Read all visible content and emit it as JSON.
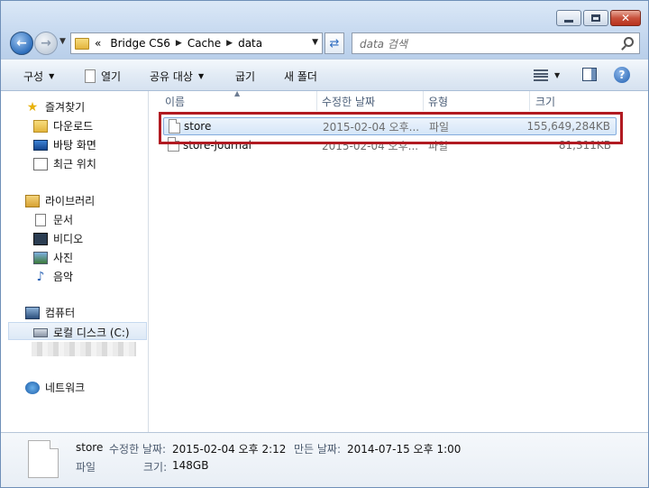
{
  "window": {
    "controls": [
      "minimize",
      "maximize",
      "close"
    ]
  },
  "address": {
    "prefix": "«",
    "crumbs": [
      "Bridge CS6",
      "Cache",
      "data"
    ]
  },
  "search": {
    "placeholder": "data 검색"
  },
  "toolbar": {
    "organize": "구성",
    "open": "열기",
    "share": "공유 대상",
    "burn": "굽기",
    "new_folder": "새 폴더"
  },
  "sidebar": {
    "favorites": {
      "label": "즐겨찾기",
      "items": [
        "다운로드",
        "바탕 화면",
        "최근 위치"
      ]
    },
    "libraries": {
      "label": "라이브러리",
      "items": [
        "문서",
        "비디오",
        "사진",
        "음악"
      ]
    },
    "computer": {
      "label": "컴퓨터",
      "items": [
        "로컬 디스크 (C:)"
      ]
    },
    "network": {
      "label": "네트워크"
    }
  },
  "columns": {
    "name": "이름",
    "date": "수정한 날짜",
    "type": "유형",
    "size": "크기"
  },
  "files": [
    {
      "name": "store",
      "date": "2015-02-04 오후...",
      "type": "파일",
      "size": "155,649,284KB",
      "selected": true
    },
    {
      "name": "store-journal",
      "date": "2015-02-04 오후...",
      "type": "파일",
      "size": "81,311KB",
      "selected": false
    }
  ],
  "details": {
    "name": "store",
    "type": "파일",
    "modified_label": "수정한 날짜:",
    "modified": "2015-02-04 오후 2:12",
    "created_label": "만든 날짜:",
    "created": "2014-07-15 오후 1:00",
    "size_label": "크기:",
    "size": "148GB"
  },
  "colors": {
    "highlight_border": "#b11a21",
    "selection": "#d5e6f8",
    "accent": "#2e6fbd"
  },
  "icons": [
    "back-icon",
    "forward-icon",
    "folder-icon",
    "refresh-icon",
    "search-icon",
    "view-icon",
    "preview-pane-icon",
    "help-icon",
    "star-icon",
    "network-icon"
  ]
}
